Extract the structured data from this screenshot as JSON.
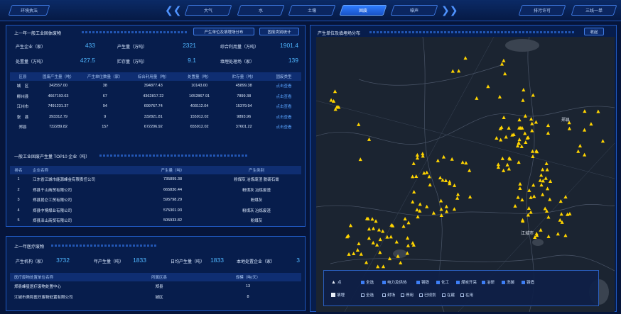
{
  "topbar": {
    "left_button": "环境执法",
    "tabs": [
      "大气",
      "水",
      "土壤",
      "固废",
      "噪声"
    ],
    "active_tab": "固废",
    "right_buttons": [
      "排污许可",
      "三线一单"
    ]
  },
  "panel1": {
    "title": "上一年一般工业固体废物",
    "tab1": "产生单位及填埋场分布",
    "tab2": "固废类别统计",
    "stats": [
      {
        "label": "产生企业（家）",
        "value": "433"
      },
      {
        "label": "产生量（万吨）",
        "value": "2321"
      },
      {
        "label": "综合利用量（万吨）",
        "value": "1901.4"
      },
      {
        "label": "处置量（万吨）",
        "value": "427.5"
      },
      {
        "label": "贮存量（万吨）",
        "value": "9.1"
      },
      {
        "label": "填埋处理场（家）",
        "value": "139"
      }
    ],
    "table": {
      "headers": [
        "区县",
        "固废产生量（吨）",
        "产生单位数量（家）",
        "综合利用量（吨）",
        "处置量（吨）",
        "贮存量（吨）",
        "固废类型"
      ],
      "rows": [
        [
          "城　区",
          "342557.00",
          "38",
          "394877.43",
          "10143.00",
          "45899.38",
          "点击查看"
        ],
        [
          "柳州县",
          "4667193.63",
          "67",
          "4362817.22",
          "1052867.91",
          "7899.38",
          "点击查看"
        ],
        [
          "江州市",
          "7491231.37",
          "94",
          "699767.74",
          "403112.04",
          "15379.94",
          "点击查看"
        ],
        [
          "张　县",
          "393312.79",
          "9",
          "332821.81",
          "155912.02",
          "9893.96",
          "点击查看"
        ],
        [
          "郑县",
          "732289.82",
          "157",
          "672206.92",
          "655912.02",
          "37601.22",
          "点击查看"
        ]
      ]
    },
    "top10": {
      "title": "一般工业固废产生量 TOP10 企业（吨）",
      "headers": [
        "排名",
        "企业名称",
        "产生量（吨）",
        "产生类别"
      ],
      "rows": [
        [
          "1",
          "江东省江城市能源峰金有限责任公司",
          "735899.38",
          "粉煤灰 冶炼废渣 脱硫石膏"
        ],
        [
          "2",
          "郑县千山商贸有限公司",
          "665830.44",
          "粉煤灰 冶炼废渣"
        ],
        [
          "3",
          "郑县昆仑工贸有限公司",
          "595798.29",
          "粉煤灰"
        ],
        [
          "4",
          "郑县中博煤业有限公司",
          "575301.93",
          "粉煤灰 冶炼废渣"
        ],
        [
          "5",
          "郑县泽山商贸有限公司",
          "505933.82",
          "粉煤灰"
        ]
      ]
    }
  },
  "panel2": {
    "title": "上一年医疗废物",
    "stats": [
      {
        "label": "产生机构（家）",
        "value": "3732"
      },
      {
        "label": "年产生量（吨）",
        "value": "1833"
      },
      {
        "label": "日均产生量（吨）",
        "value": "1833"
      },
      {
        "label": "本地处置企业（家）",
        "value": "3"
      }
    ],
    "headers": [
      "医疗废物处置单位名称",
      "所属区县",
      "规模（吨/天）"
    ],
    "rows": [
      [
        "郑县峰星医疗废物处置中心",
        "郑县",
        "13"
      ],
      [
        "江城市美和医疗废物处置有限公司",
        "城区",
        "8"
      ]
    ]
  },
  "map_panel": {
    "title": "产生单位及填埋场分布",
    "collapse_button": "收起",
    "labels": [
      "郑县",
      "江城市"
    ],
    "legend": {
      "row1_key": "点",
      "row1_items": [
        "全选",
        "电力及供热",
        "钢铁",
        "化工",
        "煤炭开采",
        "冶研",
        "洗碳",
        "铸造"
      ],
      "row2_key": "填埋",
      "row2_items": [
        "全选",
        "封场",
        "停用",
        "已规划",
        "在建",
        "在用"
      ]
    }
  },
  "colors": {
    "accent": "#4fb6ff",
    "marker": "#ffd400",
    "active_tab": "#2e7cff"
  }
}
